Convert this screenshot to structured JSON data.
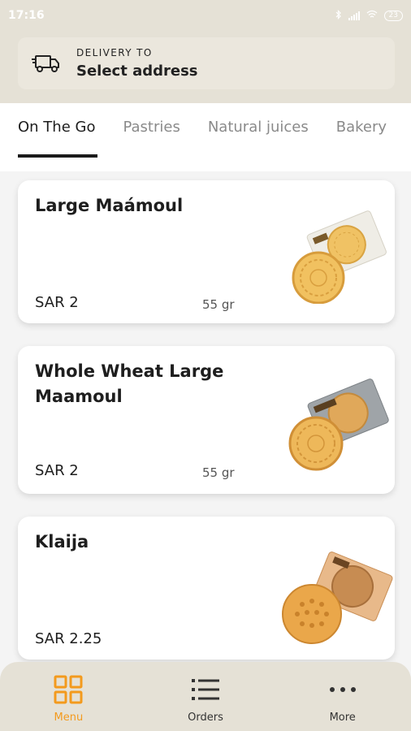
{
  "status_bar": {
    "time": "17:16",
    "battery": "23"
  },
  "delivery": {
    "label": "DELIVERY TO",
    "value": "Select address"
  },
  "tabs": [
    {
      "label": "On The Go",
      "active": true
    },
    {
      "label": "Pastries",
      "active": false
    },
    {
      "label": "Natural juices",
      "active": false
    },
    {
      "label": "Bakery",
      "active": false
    }
  ],
  "products": [
    {
      "name": "Large Maámoul",
      "price": "SAR 2",
      "weight": "55 gr"
    },
    {
      "name": "Whole Wheat Large Maamoul",
      "price": "SAR 2",
      "weight": "55 gr"
    },
    {
      "name": "Klaija",
      "price": "SAR 2.25",
      "weight": ""
    }
  ],
  "bottom_nav": [
    {
      "label": "Menu",
      "icon": "grid-icon",
      "active": true
    },
    {
      "label": "Orders",
      "icon": "list-icon",
      "active": false
    },
    {
      "label": "More",
      "icon": "more-dots-icon",
      "active": false
    }
  ],
  "colors": {
    "accent": "#f39a1d",
    "header_bg": "#e5e1d6"
  }
}
